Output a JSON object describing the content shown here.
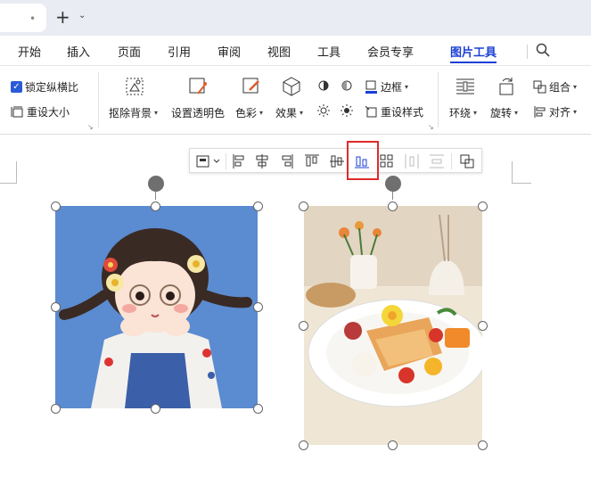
{
  "titlebar": {
    "tab_dot": "•",
    "new_tab": "+",
    "new_tab_arrow": "⌄"
  },
  "menu": {
    "items": [
      "开始",
      "插入",
      "页面",
      "引用",
      "审阅",
      "视图",
      "工具",
      "会员专享",
      "图片工具"
    ],
    "active": "图片工具"
  },
  "ribbon": {
    "lock_ratio": "锁定纵横比",
    "reset_size": "重设大小",
    "remove_bg": "抠除背景",
    "set_transparent": "设置透明色",
    "color": "色彩",
    "effect": "效果",
    "border": "边框",
    "reset_style": "重设样式",
    "wrap": "环绕",
    "rotate": "旋转",
    "group": "组合",
    "align": "对齐"
  },
  "floating_toolbar": {
    "buttons": [
      "layout-options",
      "align-left",
      "align-center",
      "align-right",
      "align-top",
      "align-middle",
      "align-bottom",
      "distribute-grid",
      "distribute-horizontal",
      "distribute-vertical",
      "group-objects"
    ],
    "highlighted": "align-bottom"
  },
  "images": [
    {
      "name": "girl-portrait",
      "bg_color": "#5b8bd0"
    },
    {
      "name": "breakfast-plate",
      "bg_color": "#efe6d6"
    }
  ],
  "colors": {
    "accent": "#1a3fd6",
    "highlight": "#e02a2a"
  }
}
